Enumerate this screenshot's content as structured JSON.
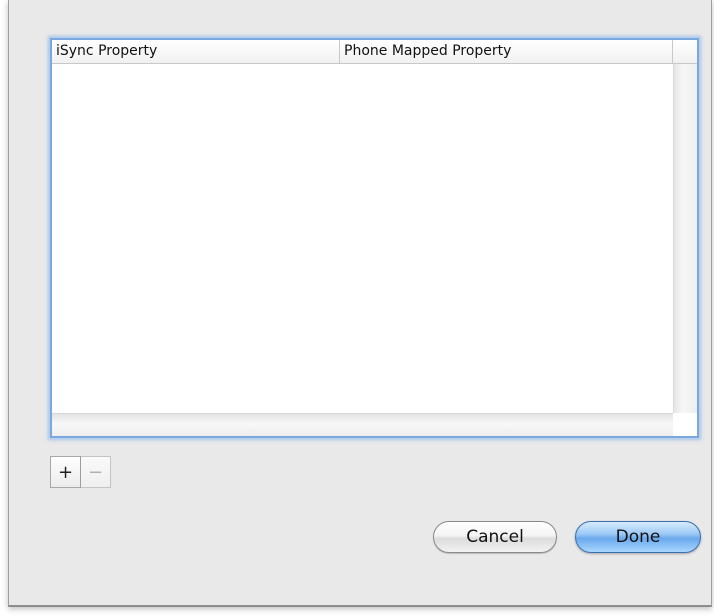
{
  "table": {
    "columns": [
      {
        "label": "iSync Property"
      },
      {
        "label": "Phone Mapped Property"
      }
    ],
    "rows": []
  },
  "controls": {
    "add_label": "+",
    "remove_label": "−"
  },
  "buttons": {
    "cancel_label": "Cancel",
    "done_label": "Done"
  },
  "colors": {
    "focus_ring": "#7aa7df",
    "default_button": "#6aa9ec",
    "sheet_background": "#e9e9e9"
  }
}
